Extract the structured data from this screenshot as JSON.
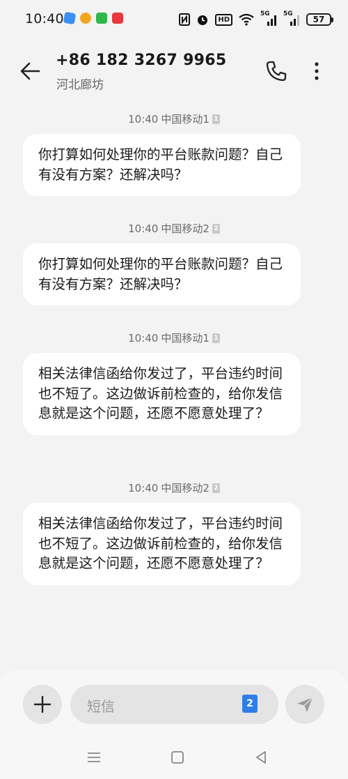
{
  "status_bar": {
    "time": "10:40",
    "battery": "57",
    "network_5g_1": "5G",
    "network_5g_2": "5G",
    "hd": "HD"
  },
  "header": {
    "contact_number": "+86 182 3267 9965",
    "contact_location": "河北廊坊"
  },
  "messages": [
    {
      "time": "10:40",
      "carrier": "中国移动1",
      "sim": "1",
      "text": "你打算如何处理你的平台账款问题？自己有没有方案？还解决吗？"
    },
    {
      "time": "10:40",
      "carrier": "中国移动2",
      "sim": "2",
      "text": "你打算如何处理你的平台账款问题？自己有没有方案？还解决吗？"
    },
    {
      "time": "10:40",
      "carrier": "中国移动1",
      "sim": "1",
      "text": "相关法律信函给你发过了，平台违约时间也不短了。这边做诉前检查的，给你发信息就是这个问题，还愿不愿意处理了？"
    },
    {
      "time": "10:40",
      "carrier": "中国移动2",
      "sim": "2",
      "text": "相关法律信函给你发过了，平台违约时间也不短了。这边做诉前检查的，给你发信息就是这个问题，还愿不愿意处理了？"
    }
  ],
  "composer": {
    "placeholder": "短信",
    "sim_selected": "2"
  },
  "icons": {
    "back": "arrow-left-icon",
    "call": "phone-icon",
    "more": "more-vertical-icon",
    "add": "plus-icon",
    "send": "send-icon"
  }
}
